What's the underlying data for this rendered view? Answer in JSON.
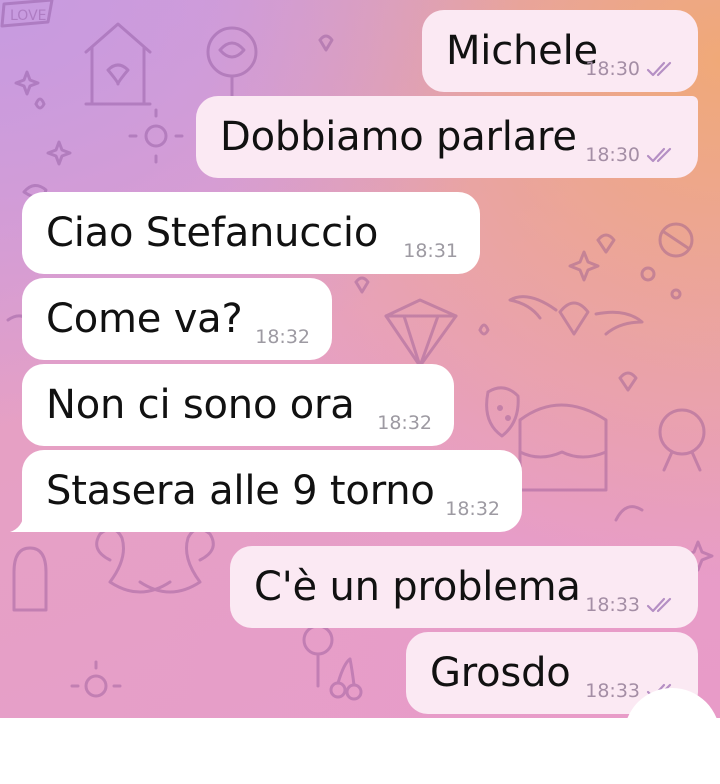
{
  "chat": {
    "messages": [
      {
        "direction": "out",
        "text": "Michele",
        "time": "18:30",
        "status": "read"
      },
      {
        "direction": "out",
        "text": "Dobbiamo parlare",
        "time": "18:30",
        "status": "read"
      },
      {
        "direction": "in",
        "text": "Ciao Stefanuccio",
        "time": "18:31"
      },
      {
        "direction": "in",
        "text": "Come va?",
        "time": "18:32"
      },
      {
        "direction": "in",
        "text": "Non ci sono ora",
        "time": "18:32"
      },
      {
        "direction": "in",
        "text": "Stasera alle 9 torno",
        "time": "18:32"
      },
      {
        "direction": "out",
        "text": "C'è un problema",
        "time": "18:33",
        "status": "read"
      },
      {
        "direction": "out",
        "text": "Grosdo",
        "time": "18:33",
        "status": "read"
      }
    ],
    "wallpaper_doodle": "LOVE"
  },
  "icons": {
    "read_status": "double-check-icon",
    "scroll_down": "scroll-down-button"
  },
  "colors": {
    "incoming_bubble": "#ffffff",
    "outgoing_bubble": "#fbe9f3",
    "tick": "#b58fc4",
    "timestamp": "#9d9aa2"
  }
}
